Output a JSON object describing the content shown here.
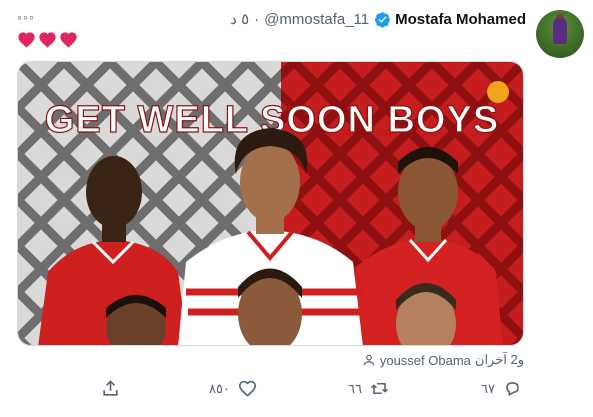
{
  "tweet": {
    "author_name": "Mostafa Mohamed",
    "handle": "@mmostafa_11",
    "separator": "·",
    "time": "٥ د",
    "more": "◦◦◦",
    "hearts": [
      "❤",
      "❤",
      "❤"
    ]
  },
  "image": {
    "headline": "GET WELL SOON BOYS"
  },
  "tagged": {
    "text": "youssef Obama",
    "others": "و2 آخران"
  },
  "actions": {
    "reply_count": "٦٧",
    "retweet_count": "٦٦",
    "like_count": "٨٥٠",
    "share_label": ""
  },
  "colors": {
    "accent": "#1d9bf0",
    "heart": "#e0245e",
    "red_bg": "#c21f1f",
    "grey_bg": "#d6d6d6"
  }
}
